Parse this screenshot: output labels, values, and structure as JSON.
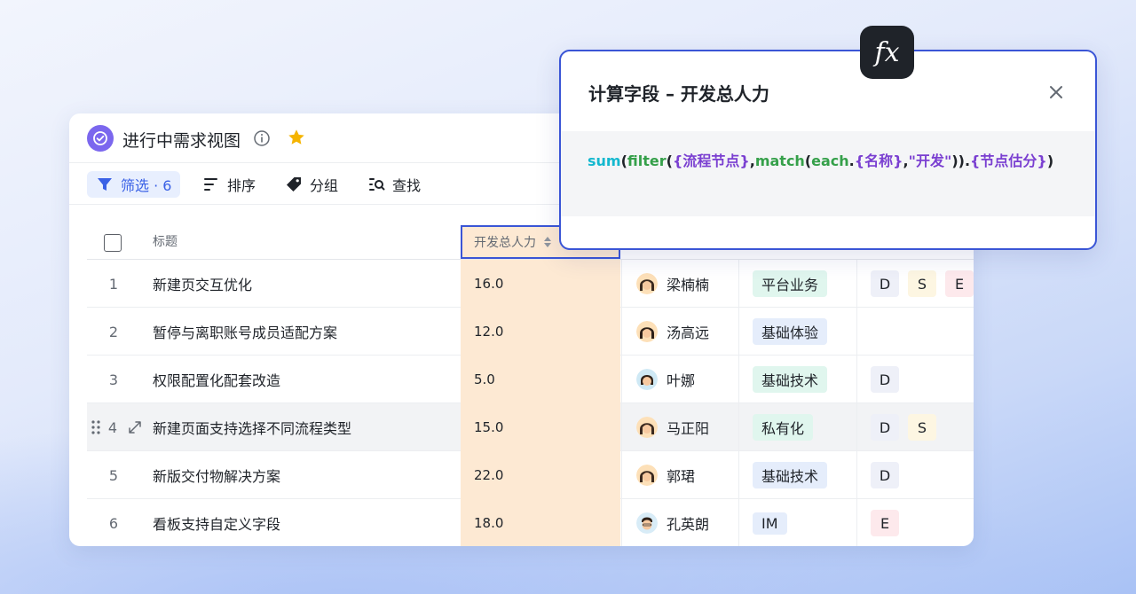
{
  "view": {
    "title": "进行中需求视图",
    "toolbar": {
      "filter_label": "筛选 · 6",
      "sort_label": "排序",
      "group_label": "分组",
      "find_label": "查找"
    }
  },
  "table": {
    "headers": {
      "title": "标题",
      "dev_manpower": "开发总人力"
    },
    "rows": [
      {
        "num": "1",
        "title": "新建页交互优化",
        "dev": "16.0",
        "owner": "梁楠楠",
        "biz": "平台业务",
        "tags": [
          "D",
          "S",
          "E"
        ]
      },
      {
        "num": "2",
        "title": "暂停与离职账号成员适配方案",
        "dev": "12.0",
        "owner": "汤高远",
        "biz": "基础体验",
        "tags": []
      },
      {
        "num": "3",
        "title": "权限配置化配套改造",
        "dev": "5.0",
        "owner": "叶娜",
        "biz": "基础技术",
        "tags": [
          "D"
        ]
      },
      {
        "num": "4",
        "title": "新建页面支持选择不同流程类型",
        "dev": "15.0",
        "owner": "马正阳",
        "biz": "私有化",
        "tags": [
          "D",
          "S"
        ]
      },
      {
        "num": "5",
        "title": "新版交付物解决方案",
        "dev": "22.0",
        "owner": "郭珺",
        "biz": "基础技术",
        "tags": [
          "D"
        ]
      },
      {
        "num": "6",
        "title": "看板支持自定义字段",
        "dev": "18.0",
        "owner": "孔英朗",
        "biz": "IM",
        "tags": [
          "E"
        ]
      }
    ]
  },
  "popup": {
    "title": "计算字段 – 开发总人力",
    "fx_label": "fx",
    "formula": {
      "fn_sum": "sum",
      "fn_filter": "filter",
      "field_flow_node": "{流程节点}",
      "fn_match": "match",
      "fn_each": "each",
      "field_name": "{名称}",
      "str_dev": "\"开发\"",
      "field_node_score": "{节点估分}"
    }
  },
  "colors": {
    "accent": "#3a55d6",
    "dev_column_bg": "#fde9d3",
    "view_icon": "#7b67ee",
    "star": "#f5b400"
  }
}
